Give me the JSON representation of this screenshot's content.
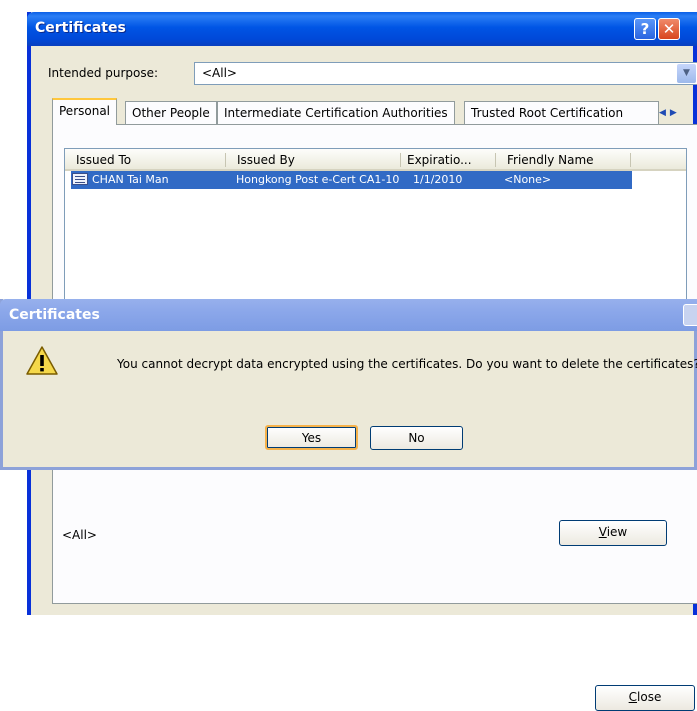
{
  "window": {
    "title": "Certificates",
    "help_glyph": "?",
    "close_glyph": "✕",
    "intended_purpose_label": "Intended purpose:",
    "intended_purpose_value": "<All>",
    "tabs": [
      {
        "label": "Personal",
        "active": true
      },
      {
        "label": "Other People"
      },
      {
        "label": "Intermediate Certification Authorities"
      },
      {
        "label": "Trusted Root Certification"
      }
    ],
    "tab_scroll_glyphs": "◀▶",
    "columns": [
      "Issued To",
      "Issued By",
      "Expiratio...",
      "Friendly Name"
    ],
    "rows": [
      {
        "issued_to": "CHAN Tai Man",
        "issued_by": "Hongkong Post e-Cert CA1-10",
        "expiration": "1/1/2010",
        "friendly_name": "<None>",
        "selected": true
      }
    ],
    "certificate_purposes_value": "<All>",
    "view_button": "View",
    "close_button": "Close"
  },
  "dialog": {
    "title": "Certificates",
    "message": "You cannot decrypt data encrypted using the certificates. Do you want to delete the certificates?",
    "yes_button": "Yes",
    "no_button": "No",
    "icon": "warning-icon"
  },
  "colors": {
    "titlebar_blue": "#0055e5",
    "selection_blue": "#316ac5",
    "dialog_inactive_titlebar": "#8ba7ea",
    "window_face": "#ece9d8"
  }
}
